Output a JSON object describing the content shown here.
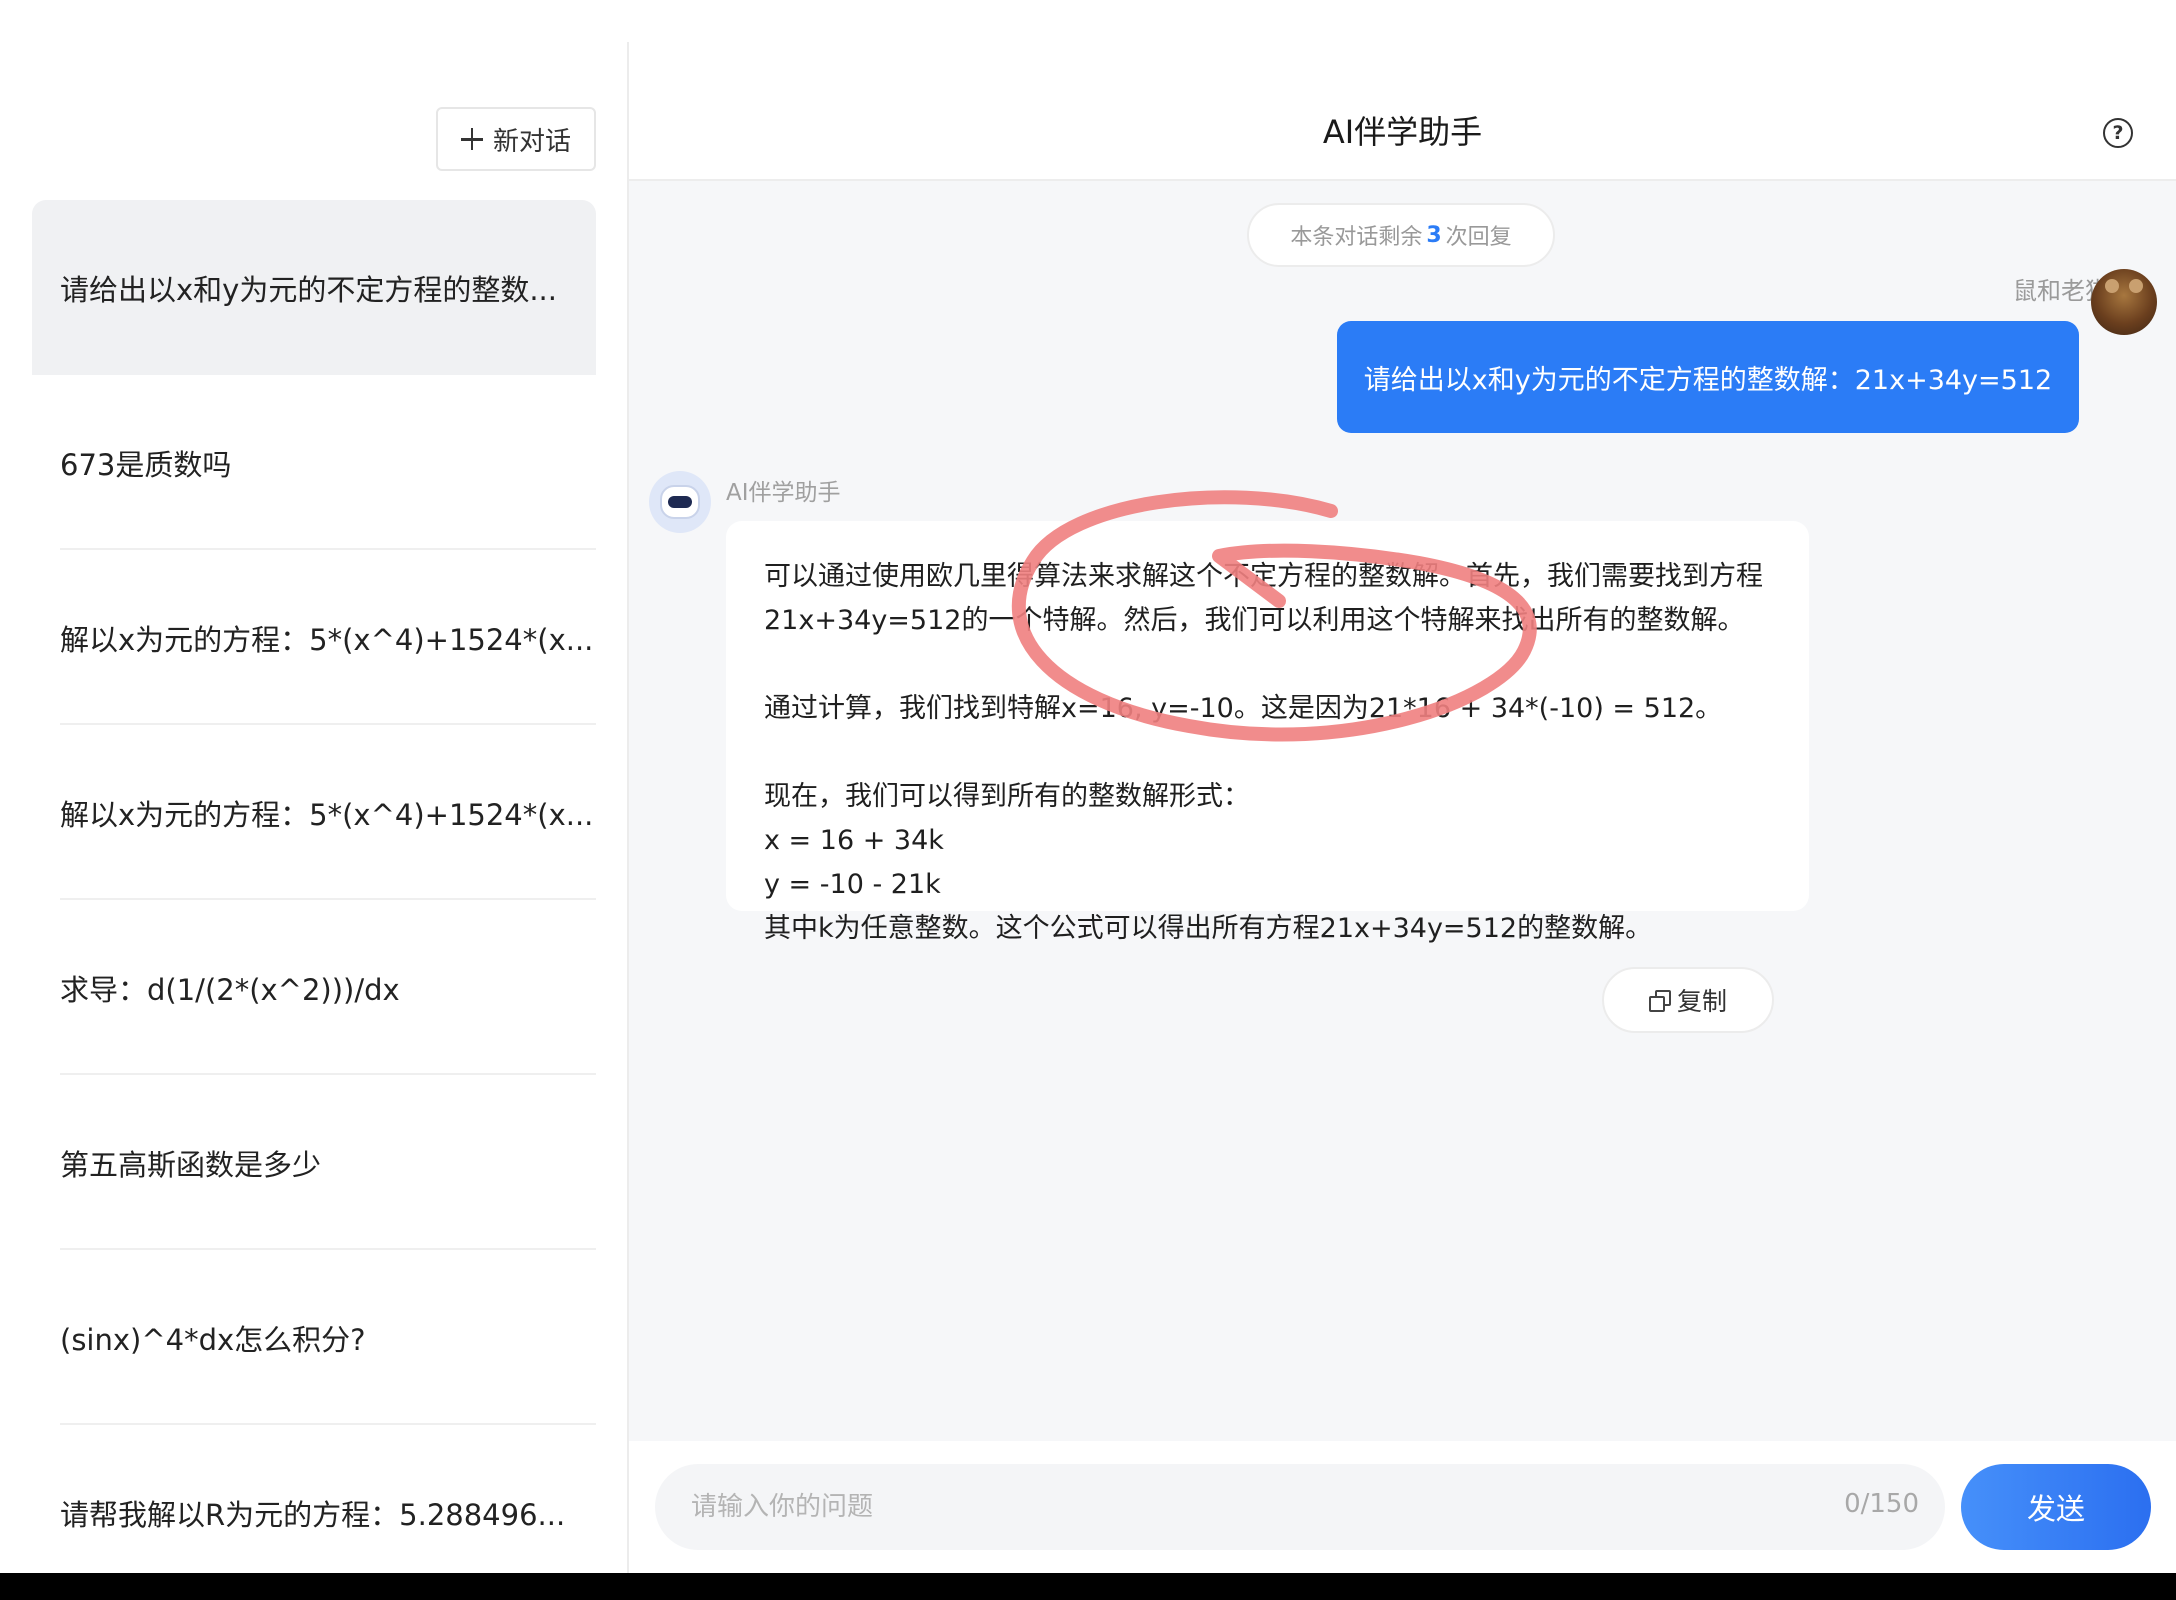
{
  "sidebar": {
    "new_chat_label": "新对话",
    "history": [
      "请给出以x和y为元的不定方程的整数...",
      "673是质数吗",
      "解以x为元的方程：5*(x^4)+1524*(x...",
      "解以x为元的方程：5*(x^4)+1524*(x...",
      "求导：d(1/(2*(x^2)))/dx",
      "第五高斯函数是多少",
      "(sinx)^4*dx怎么积分?",
      "请帮我解以R为元的方程：5.288496..."
    ]
  },
  "header": {
    "title": "AI伴学助手",
    "help_icon": "question-circle-icon"
  },
  "chat": {
    "remaining_prefix": "本条对话剩余",
    "remaining_count": "3",
    "remaining_suffix": "次回复",
    "user": {
      "name": "鼠和老猫",
      "message": "请给出以x和y为元的不定方程的整数解：21x+34y=512"
    },
    "assistant": {
      "name": "AI伴学助手",
      "message": "可以通过使用欧几里得算法来求解这个不定方程的整数解。首先，我们需要找到方程21x+34y=512的一个特解。然后，我们可以利用这个特解来找出所有的整数解。\n\n通过计算，我们找到特解x=16, y=-10。这是因为21*16 + 34*(-10) = 512。\n\n现在，我们可以得到所有的整数解形式：\nx = 16 + 34k\ny = -10 - 21k\n其中k为任意整数。这个公式可以得出所有方程21x+34y=512的整数解。",
      "copy_label": "复制"
    },
    "annotation_color": "#f08080"
  },
  "composer": {
    "placeholder": "请输入你的问题",
    "counter": "0/150",
    "send_label": "发送"
  },
  "colors": {
    "accent": "#2b7cf6",
    "sidebar_active": "#f0f1f3",
    "chat_bg": "#f6f7f9"
  }
}
